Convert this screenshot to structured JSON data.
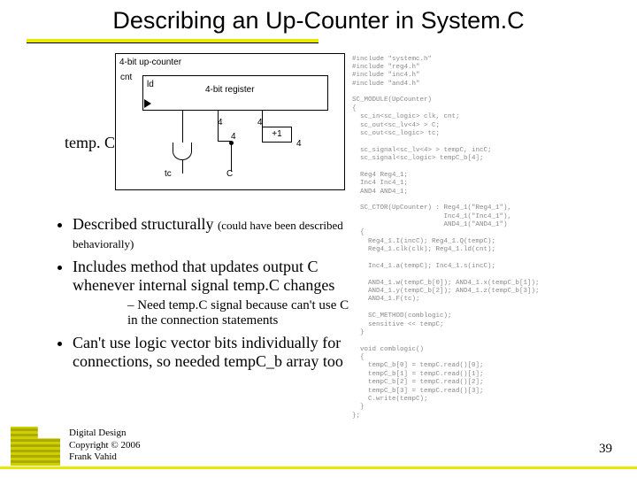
{
  "title": "Describing an Up-Counter in System.C",
  "diagram": {
    "box_title": "4-bit up-counter",
    "reg_ld": "ld",
    "reg_label": "4-bit register",
    "cnt": "cnt",
    "tempc": "temp. C",
    "tc": "tc",
    "c": "C",
    "inc": "+1",
    "w4": "4"
  },
  "bullets": {
    "b1a": "Described structurally ",
    "b1b": "(could have been described behaviorally)",
    "b2": "Includes method that updates output C whenever internal signal temp.C changes",
    "b2s1": "Need temp.C signal because can't use C in the connection statements",
    "b3": "Can't use logic vector bits individually for connections, so needed tempC_b array too"
  },
  "footer": {
    "l1": "Digital Design",
    "l2": "Copyright © 2006",
    "l3": "Frank Vahid"
  },
  "slide_num": "39",
  "code": "#include \"systemc.h\"\n#include \"reg4.h\"\n#include \"inc4.h\"\n#include \"and4.h\"\n\nSC_MODULE(UpCounter)\n{\n  sc_in<sc_logic> clk, cnt;\n  sc_out<sc_lv<4> > C;\n  sc_out<sc_logic> tc;\n\n  sc_signal<sc_lv<4> > tempC, incC;\n  sc_signal<sc_logic> tempC_b[4];\n\n  Reg4 Reg4_1;\n  Inc4 Inc4_1;\n  AND4 AND4_1;\n\n  SC_CTOR(UpCounter) : Reg4_1(\"Reg4_1\"),\n                       Inc4_1(\"Inc4_1\"),\n                       AND4_1(\"AND4_1\")\n  {\n    Reg4_1.I(incC); Reg4_1.Q(tempC);\n    Reg4_1.clk(clk); Reg4_1.ld(cnt);\n\n    Inc4_1.a(tempC); Inc4_1.s(incC);\n\n    AND4_1.w(tempC_b[0]); AND4_1.x(tempC_b[1]);\n    AND4_1.y(tempC_b[2]); AND4_1.z(tempC_b[3]);\n    AND4_1.F(tc);\n\n    SC_METHOD(comblogic);\n    sensitive << tempC;\n  }\n\n  void comblogic()\n  {\n    tempC_b[0] = tempC.read()[0];\n    tempC_b[1] = tempC.read()[1];\n    tempC_b[2] = tempC.read()[2];\n    tempC_b[3] = tempC.read()[3];\n    C.write(tempC);\n  }\n};"
}
